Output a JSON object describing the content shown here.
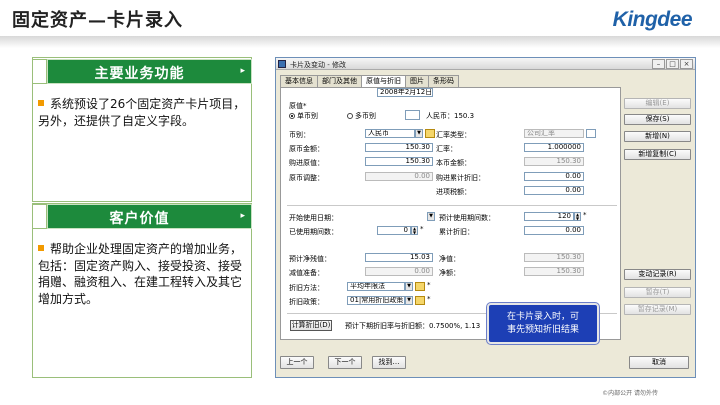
{
  "slide": {
    "title": "固定资产—卡片录入",
    "logo": "Kingdee",
    "footer": "©内部公开 请勿外传"
  },
  "panels": [
    {
      "heading": "主要业务功能",
      "arrow": "▸",
      "text": "系统预设了26个固定资产卡片项目，另外，还提供了自定义字段。"
    },
    {
      "heading": "客户价值",
      "arrow": "▸",
      "text": "帮助企业处理固定资产的增加业务，包括：固定资产购入、接受投资、接受捐赠、融资租入、在建工程转入及其它增加方式。"
    }
  ],
  "dialog": {
    "title": "卡片及变动 - 修改",
    "tabs": [
      "基本信息",
      "部门及其他",
      "原值与折旧",
      "图片",
      "条形码"
    ],
    "active_tab": "原值与折旧",
    "original_value": {
      "label": "原值*",
      "single_currency": "单币别",
      "multi_currency": "多币别",
      "rmb_display": "人民币：150.3"
    },
    "fields": {
      "currency_label": "币别：",
      "currency_value": "人民币",
      "rate_type_label": "汇率类型：",
      "rate_type_value": "公司汇率",
      "orig_amount_label": "原币金额：",
      "orig_amount_value": "150.30",
      "rate_label": "汇率：",
      "rate_value": "1.000000",
      "purchase_value_label": "购进原值：",
      "purchase_value_value": "150.30",
      "local_amount_label": "本币金额：",
      "local_amount_value": "150.30",
      "orig_adjust_label": "原币调整：",
      "orig_adjust_value": "0.00",
      "purchase_accum_dep_label": "购进累计折旧：",
      "purchase_accum_dep_value": "0.00",
      "import_tax_label": "进项税额：",
      "import_tax_value": "0.00",
      "start_date_label": "开始使用日期：",
      "start_date_value": "2008年2月12日",
      "est_period_label": "预计使用期间数：",
      "est_period_value": "120",
      "used_period_label": "已使用期间数：",
      "used_period_value": "0",
      "accum_dep_label": "累计折旧：",
      "accum_dep_value": "0.00",
      "est_residual_label": "预计净残值：",
      "est_residual_value": "15.03",
      "net_value_label": "净值：",
      "net_value_value": "150.30",
      "impairment_label": "减值准备：",
      "impairment_value": "0.00",
      "net_amount_label": "净额：",
      "net_amount_value": "150.30",
      "dep_method_label": "折旧方法：",
      "dep_method_value": "平均年限法",
      "dep_policy_label": "折旧政策：",
      "dep_policy_value": "01|常用折旧政策",
      "calc_button": "计算折旧(D)",
      "next_period_text": "预计下期折旧率与折旧额：0.7500%, 1.13"
    },
    "side_buttons": [
      {
        "label": "编辑(E)",
        "enabled": false
      },
      {
        "label": "保存(S)",
        "enabled": true
      },
      {
        "label": "新增(N)",
        "enabled": true
      },
      {
        "label": "新增复制(C)",
        "enabled": true
      },
      {
        "label": "变动记录(R)",
        "enabled": true
      },
      {
        "label": "暂存(T)",
        "enabled": false
      },
      {
        "label": "暂存记录(M)",
        "enabled": false
      }
    ],
    "bottom_buttons": {
      "prev": "上一个",
      "next": "下一个",
      "find": "找到…",
      "cancel": "取消"
    }
  },
  "callout": {
    "line1": "在卡片录入时，可",
    "line2": "事先预知折旧结果"
  }
}
